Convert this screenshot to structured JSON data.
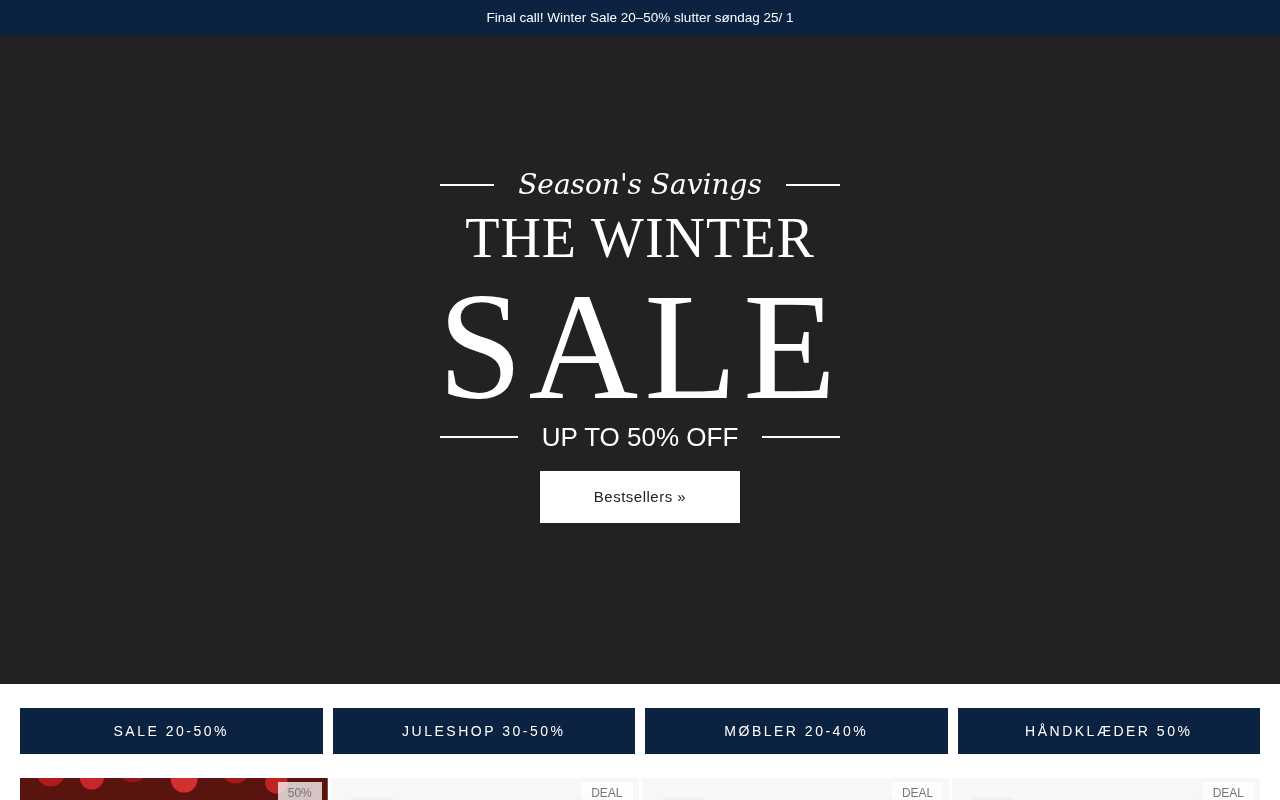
{
  "announcement": "Final call! Winter Sale 20–50% slutter søndag 25/ 1",
  "hero": {
    "kicker": "Season's Savings",
    "title": "THE WINTER",
    "headline": "SALE",
    "subtitle": "UP TO 50% OFF",
    "button": "Bestsellers »"
  },
  "categories": [
    "SALE 20-50%",
    "JULESHOP 30-50%",
    "MØBLER 20-40%",
    "HÅNDKLÆDER 50%"
  ],
  "products": [
    {
      "badge": "50%",
      "kind": "berries"
    },
    {
      "badge": "DEAL",
      "kind": "light"
    },
    {
      "badge": "DEAL",
      "kind": "light"
    },
    {
      "badge": "DEAL",
      "kind": "light"
    }
  ]
}
